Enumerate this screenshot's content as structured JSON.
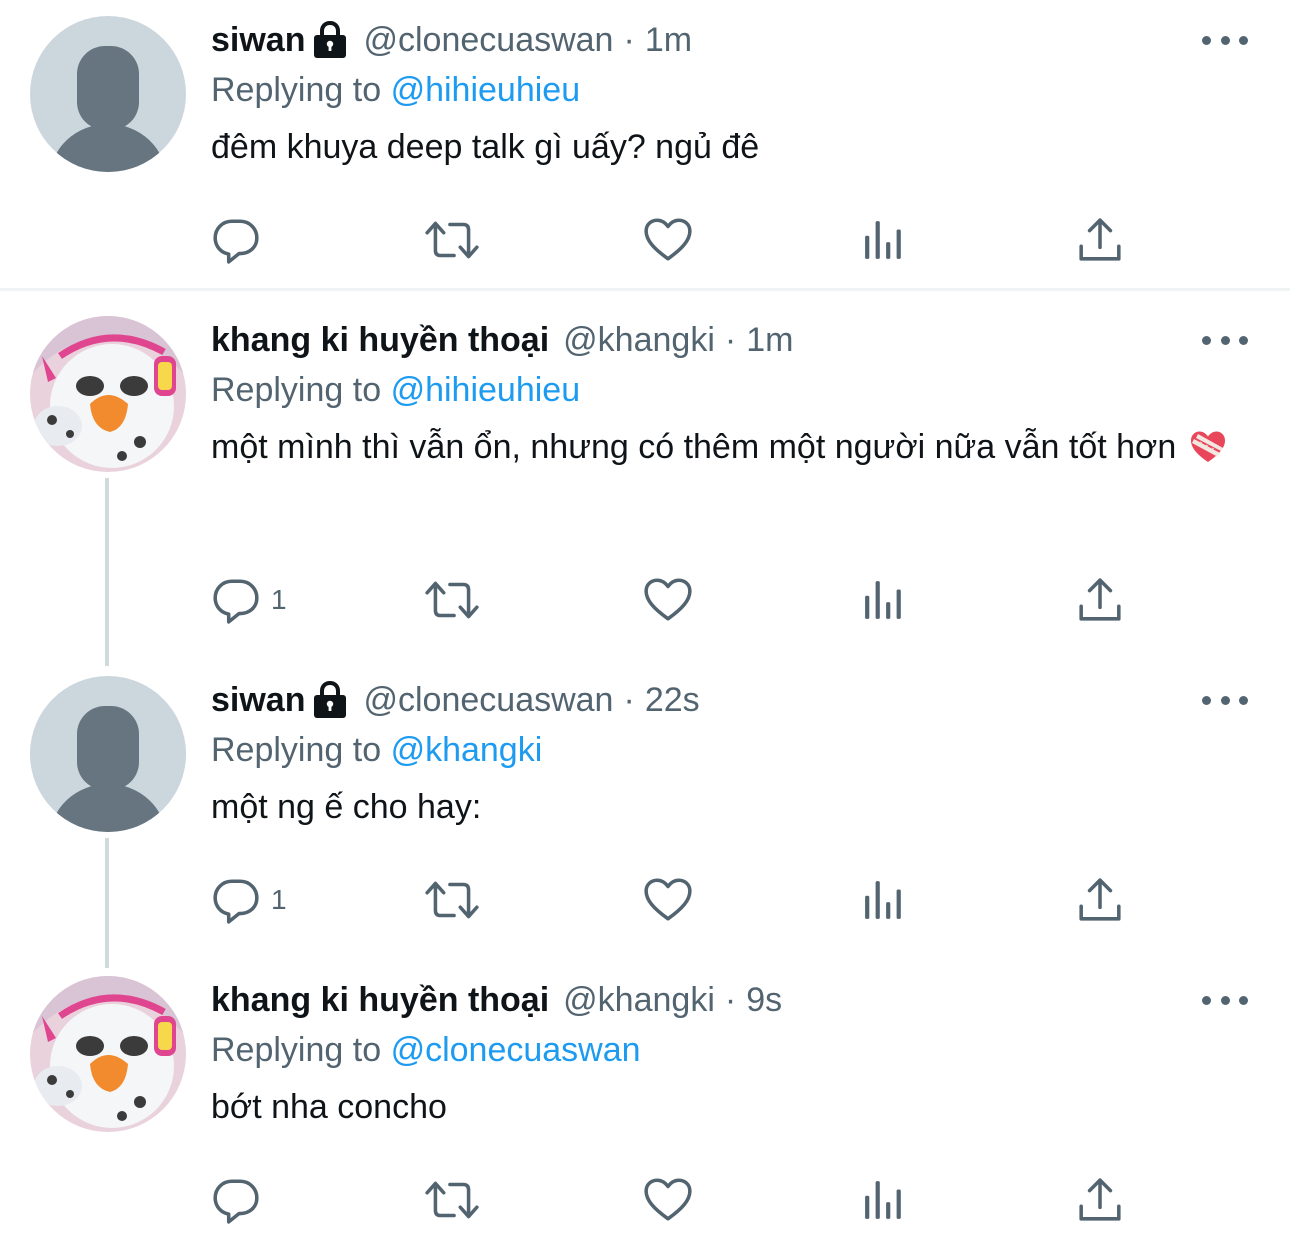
{
  "tweets": [
    {
      "name": "siwan",
      "protected": true,
      "handle": "@clonecuaswan",
      "separator": "·",
      "time": "1m",
      "replying_prefix": "Replying to",
      "replying_to": "@hihieuhieu",
      "text": "đêm khuya deep talk gì uấy? ngủ đê",
      "reply_count": "",
      "avatar": "default-avatar"
    },
    {
      "name": "khang ki huyền thoại",
      "protected": false,
      "handle": "@khangki",
      "separator": "·",
      "time": "1m",
      "replying_prefix": "Replying to",
      "replying_to": "@hihieuhieu",
      "text": "một mình thì vẫn ổn, nhưng có thêm một người nữa vẫn tốt hơn",
      "emoji": "mending-heart-emoji",
      "reply_count": "1",
      "avatar": "plush-duck-avatar"
    },
    {
      "name": "siwan",
      "protected": true,
      "handle": "@clonecuaswan",
      "separator": "·",
      "time": "22s",
      "replying_prefix": "Replying to",
      "replying_to": "@khangki",
      "text": "một ng ế cho hay:",
      "reply_count": "1",
      "avatar": "default-avatar"
    },
    {
      "name": "khang ki huyền thoại",
      "protected": false,
      "handle": "@khangki",
      "separator": "·",
      "time": "9s",
      "replying_prefix": "Replying to",
      "replying_to": "@clonecuaswan",
      "text": "bớt nha concho",
      "reply_count": "",
      "avatar": "plush-duck-avatar"
    }
  ],
  "icons": {
    "reply": "reply-icon",
    "retweet": "retweet-icon",
    "like": "like-icon",
    "views": "views-icon",
    "share": "share-icon",
    "more": "more-icon",
    "lock": "lock-icon"
  },
  "colors": {
    "text": "#0f1419",
    "secondary": "#536471",
    "link": "#1d9bf0",
    "avatar_bg": "#ccd6dd",
    "avatar_fg": "#66757f",
    "divider": "#eff3f4",
    "thread_line": "#cfd9de"
  }
}
